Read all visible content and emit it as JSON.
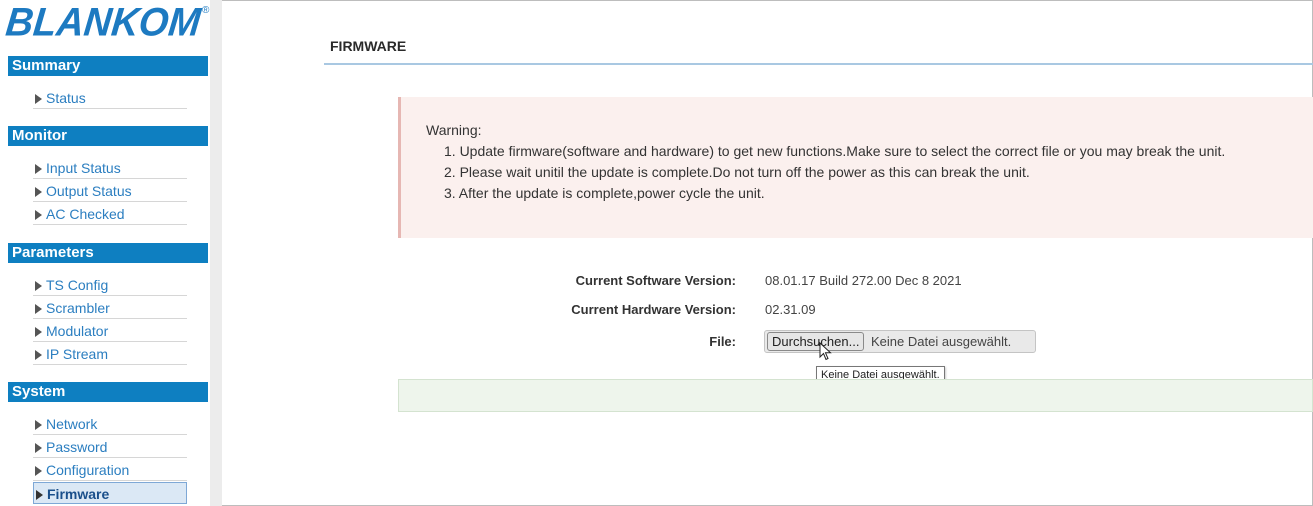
{
  "logo": {
    "text": "BLANKOM",
    "reg_mark": "®"
  },
  "sidebar": {
    "sections": [
      {
        "title": "Summary",
        "items": [
          {
            "label": "Status"
          }
        ]
      },
      {
        "title": "Monitor",
        "items": [
          {
            "label": "Input Status"
          },
          {
            "label": "Output Status"
          },
          {
            "label": "AC Checked"
          }
        ]
      },
      {
        "title": "Parameters",
        "items": [
          {
            "label": "TS Config"
          },
          {
            "label": "Scrambler"
          },
          {
            "label": "Modulator"
          },
          {
            "label": "IP Stream"
          }
        ]
      },
      {
        "title": "System",
        "items": [
          {
            "label": "Network"
          },
          {
            "label": "Password"
          },
          {
            "label": "Configuration"
          },
          {
            "label": "Firmware",
            "active": true
          }
        ]
      }
    ]
  },
  "main": {
    "title": "FIRMWARE",
    "warning": {
      "title": "Warning:",
      "lines": [
        "1. Update firmware(software and hardware) to get new functions.Make sure to select the correct file or you may break the unit.",
        "2. Please wait unitil the update is complete.Do not turn off the power as this can break the unit.",
        "3. After the update is complete,power cycle the unit."
      ]
    },
    "info": {
      "software_label": "Current Software Version:",
      "software_value": "08.01.17 Build 272.00 Dec 8 2021",
      "hardware_label": "Current Hardware Version:",
      "hardware_value": "02.31.09",
      "file_label": "File:"
    },
    "file_input": {
      "button_label": "Durchsuchen...",
      "status": "Keine Datei ausgewählt.",
      "tooltip": "Keine Datei ausgewählt."
    }
  },
  "colors": {
    "brand_blue": "#1d7ac1",
    "section_header": "#0e7fc1",
    "warning_bg": "#fbf0ee",
    "status_bg": "#eef5ec"
  }
}
